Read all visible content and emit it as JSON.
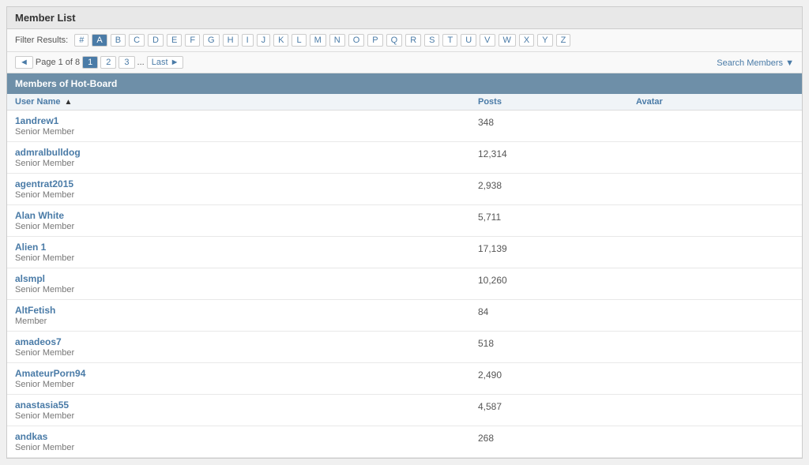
{
  "page": {
    "title": "Member List"
  },
  "filter": {
    "label": "Filter Results:",
    "buttons": [
      "#",
      "A",
      "B",
      "C",
      "D",
      "E",
      "F",
      "G",
      "H",
      "I",
      "J",
      "K",
      "L",
      "M",
      "N",
      "O",
      "P",
      "Q",
      "R",
      "S",
      "T",
      "U",
      "V",
      "W",
      "X",
      "Y",
      "Z"
    ]
  },
  "pagination": {
    "info": "Page 1 of 8",
    "prev_label": "◄",
    "pages": [
      "1",
      "2",
      "3",
      "..."
    ],
    "last_label": "Last ►",
    "search_label": "Search Members ▼",
    "active_page": "1"
  },
  "section": {
    "title": "Members of Hot-Board"
  },
  "table": {
    "columns": {
      "username": "User Name",
      "posts": "Posts",
      "avatar": "Avatar"
    },
    "members": [
      {
        "name": "1andrew1",
        "role": "Senior Member",
        "posts": "348"
      },
      {
        "name": "admralbulldog",
        "role": "Senior Member",
        "posts": "12,314"
      },
      {
        "name": "agentrat2015",
        "role": "Senior Member",
        "posts": "2,938"
      },
      {
        "name": "Alan White",
        "role": "Senior Member",
        "posts": "5,711"
      },
      {
        "name": "Alien 1",
        "role": "Senior Member",
        "posts": "17,139"
      },
      {
        "name": "alsmpl",
        "role": "Senior Member",
        "posts": "10,260"
      },
      {
        "name": "AltFetish",
        "role": "Member",
        "posts": "84"
      },
      {
        "name": "amadeos7",
        "role": "Senior Member",
        "posts": "518"
      },
      {
        "name": "AmateurPorn94",
        "role": "Senior Member",
        "posts": "2,490"
      },
      {
        "name": "anastasia55",
        "role": "Senior Member",
        "posts": "4,587"
      },
      {
        "name": "andkas",
        "role": "Senior Member",
        "posts": "268"
      }
    ]
  }
}
